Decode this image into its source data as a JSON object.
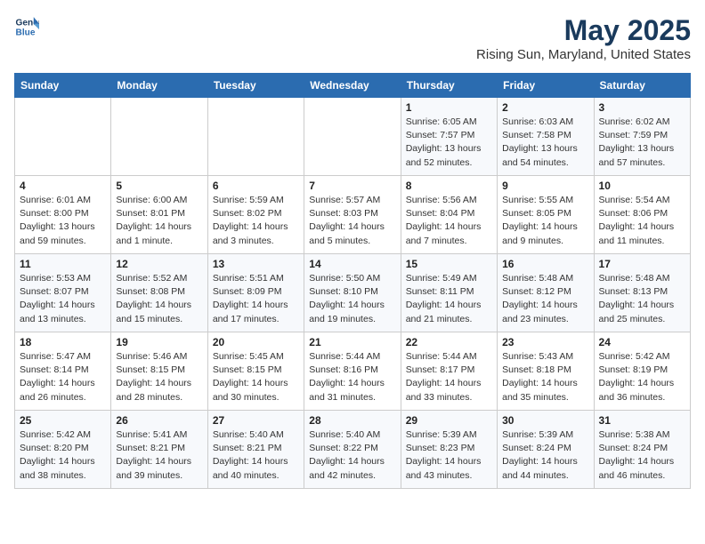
{
  "header": {
    "logo_line1": "General",
    "logo_line2": "Blue",
    "title": "May 2025",
    "subtitle": "Rising Sun, Maryland, United States"
  },
  "days_of_week": [
    "Sunday",
    "Monday",
    "Tuesday",
    "Wednesday",
    "Thursday",
    "Friday",
    "Saturday"
  ],
  "weeks": [
    [
      {
        "day": "",
        "info": ""
      },
      {
        "day": "",
        "info": ""
      },
      {
        "day": "",
        "info": ""
      },
      {
        "day": "",
        "info": ""
      },
      {
        "day": "1",
        "info": "Sunrise: 6:05 AM\nSunset: 7:57 PM\nDaylight: 13 hours\nand 52 minutes."
      },
      {
        "day": "2",
        "info": "Sunrise: 6:03 AM\nSunset: 7:58 PM\nDaylight: 13 hours\nand 54 minutes."
      },
      {
        "day": "3",
        "info": "Sunrise: 6:02 AM\nSunset: 7:59 PM\nDaylight: 13 hours\nand 57 minutes."
      }
    ],
    [
      {
        "day": "4",
        "info": "Sunrise: 6:01 AM\nSunset: 8:00 PM\nDaylight: 13 hours\nand 59 minutes."
      },
      {
        "day": "5",
        "info": "Sunrise: 6:00 AM\nSunset: 8:01 PM\nDaylight: 14 hours\nand 1 minute."
      },
      {
        "day": "6",
        "info": "Sunrise: 5:59 AM\nSunset: 8:02 PM\nDaylight: 14 hours\nand 3 minutes."
      },
      {
        "day": "7",
        "info": "Sunrise: 5:57 AM\nSunset: 8:03 PM\nDaylight: 14 hours\nand 5 minutes."
      },
      {
        "day": "8",
        "info": "Sunrise: 5:56 AM\nSunset: 8:04 PM\nDaylight: 14 hours\nand 7 minutes."
      },
      {
        "day": "9",
        "info": "Sunrise: 5:55 AM\nSunset: 8:05 PM\nDaylight: 14 hours\nand 9 minutes."
      },
      {
        "day": "10",
        "info": "Sunrise: 5:54 AM\nSunset: 8:06 PM\nDaylight: 14 hours\nand 11 minutes."
      }
    ],
    [
      {
        "day": "11",
        "info": "Sunrise: 5:53 AM\nSunset: 8:07 PM\nDaylight: 14 hours\nand 13 minutes."
      },
      {
        "day": "12",
        "info": "Sunrise: 5:52 AM\nSunset: 8:08 PM\nDaylight: 14 hours\nand 15 minutes."
      },
      {
        "day": "13",
        "info": "Sunrise: 5:51 AM\nSunset: 8:09 PM\nDaylight: 14 hours\nand 17 minutes."
      },
      {
        "day": "14",
        "info": "Sunrise: 5:50 AM\nSunset: 8:10 PM\nDaylight: 14 hours\nand 19 minutes."
      },
      {
        "day": "15",
        "info": "Sunrise: 5:49 AM\nSunset: 8:11 PM\nDaylight: 14 hours\nand 21 minutes."
      },
      {
        "day": "16",
        "info": "Sunrise: 5:48 AM\nSunset: 8:12 PM\nDaylight: 14 hours\nand 23 minutes."
      },
      {
        "day": "17",
        "info": "Sunrise: 5:48 AM\nSunset: 8:13 PM\nDaylight: 14 hours\nand 25 minutes."
      }
    ],
    [
      {
        "day": "18",
        "info": "Sunrise: 5:47 AM\nSunset: 8:14 PM\nDaylight: 14 hours\nand 26 minutes."
      },
      {
        "day": "19",
        "info": "Sunrise: 5:46 AM\nSunset: 8:15 PM\nDaylight: 14 hours\nand 28 minutes."
      },
      {
        "day": "20",
        "info": "Sunrise: 5:45 AM\nSunset: 8:15 PM\nDaylight: 14 hours\nand 30 minutes."
      },
      {
        "day": "21",
        "info": "Sunrise: 5:44 AM\nSunset: 8:16 PM\nDaylight: 14 hours\nand 31 minutes."
      },
      {
        "day": "22",
        "info": "Sunrise: 5:44 AM\nSunset: 8:17 PM\nDaylight: 14 hours\nand 33 minutes."
      },
      {
        "day": "23",
        "info": "Sunrise: 5:43 AM\nSunset: 8:18 PM\nDaylight: 14 hours\nand 35 minutes."
      },
      {
        "day": "24",
        "info": "Sunrise: 5:42 AM\nSunset: 8:19 PM\nDaylight: 14 hours\nand 36 minutes."
      }
    ],
    [
      {
        "day": "25",
        "info": "Sunrise: 5:42 AM\nSunset: 8:20 PM\nDaylight: 14 hours\nand 38 minutes."
      },
      {
        "day": "26",
        "info": "Sunrise: 5:41 AM\nSunset: 8:21 PM\nDaylight: 14 hours\nand 39 minutes."
      },
      {
        "day": "27",
        "info": "Sunrise: 5:40 AM\nSunset: 8:21 PM\nDaylight: 14 hours\nand 40 minutes."
      },
      {
        "day": "28",
        "info": "Sunrise: 5:40 AM\nSunset: 8:22 PM\nDaylight: 14 hours\nand 42 minutes."
      },
      {
        "day": "29",
        "info": "Sunrise: 5:39 AM\nSunset: 8:23 PM\nDaylight: 14 hours\nand 43 minutes."
      },
      {
        "day": "30",
        "info": "Sunrise: 5:39 AM\nSunset: 8:24 PM\nDaylight: 14 hours\nand 44 minutes."
      },
      {
        "day": "31",
        "info": "Sunrise: 5:38 AM\nSunset: 8:24 PM\nDaylight: 14 hours\nand 46 minutes."
      }
    ]
  ]
}
